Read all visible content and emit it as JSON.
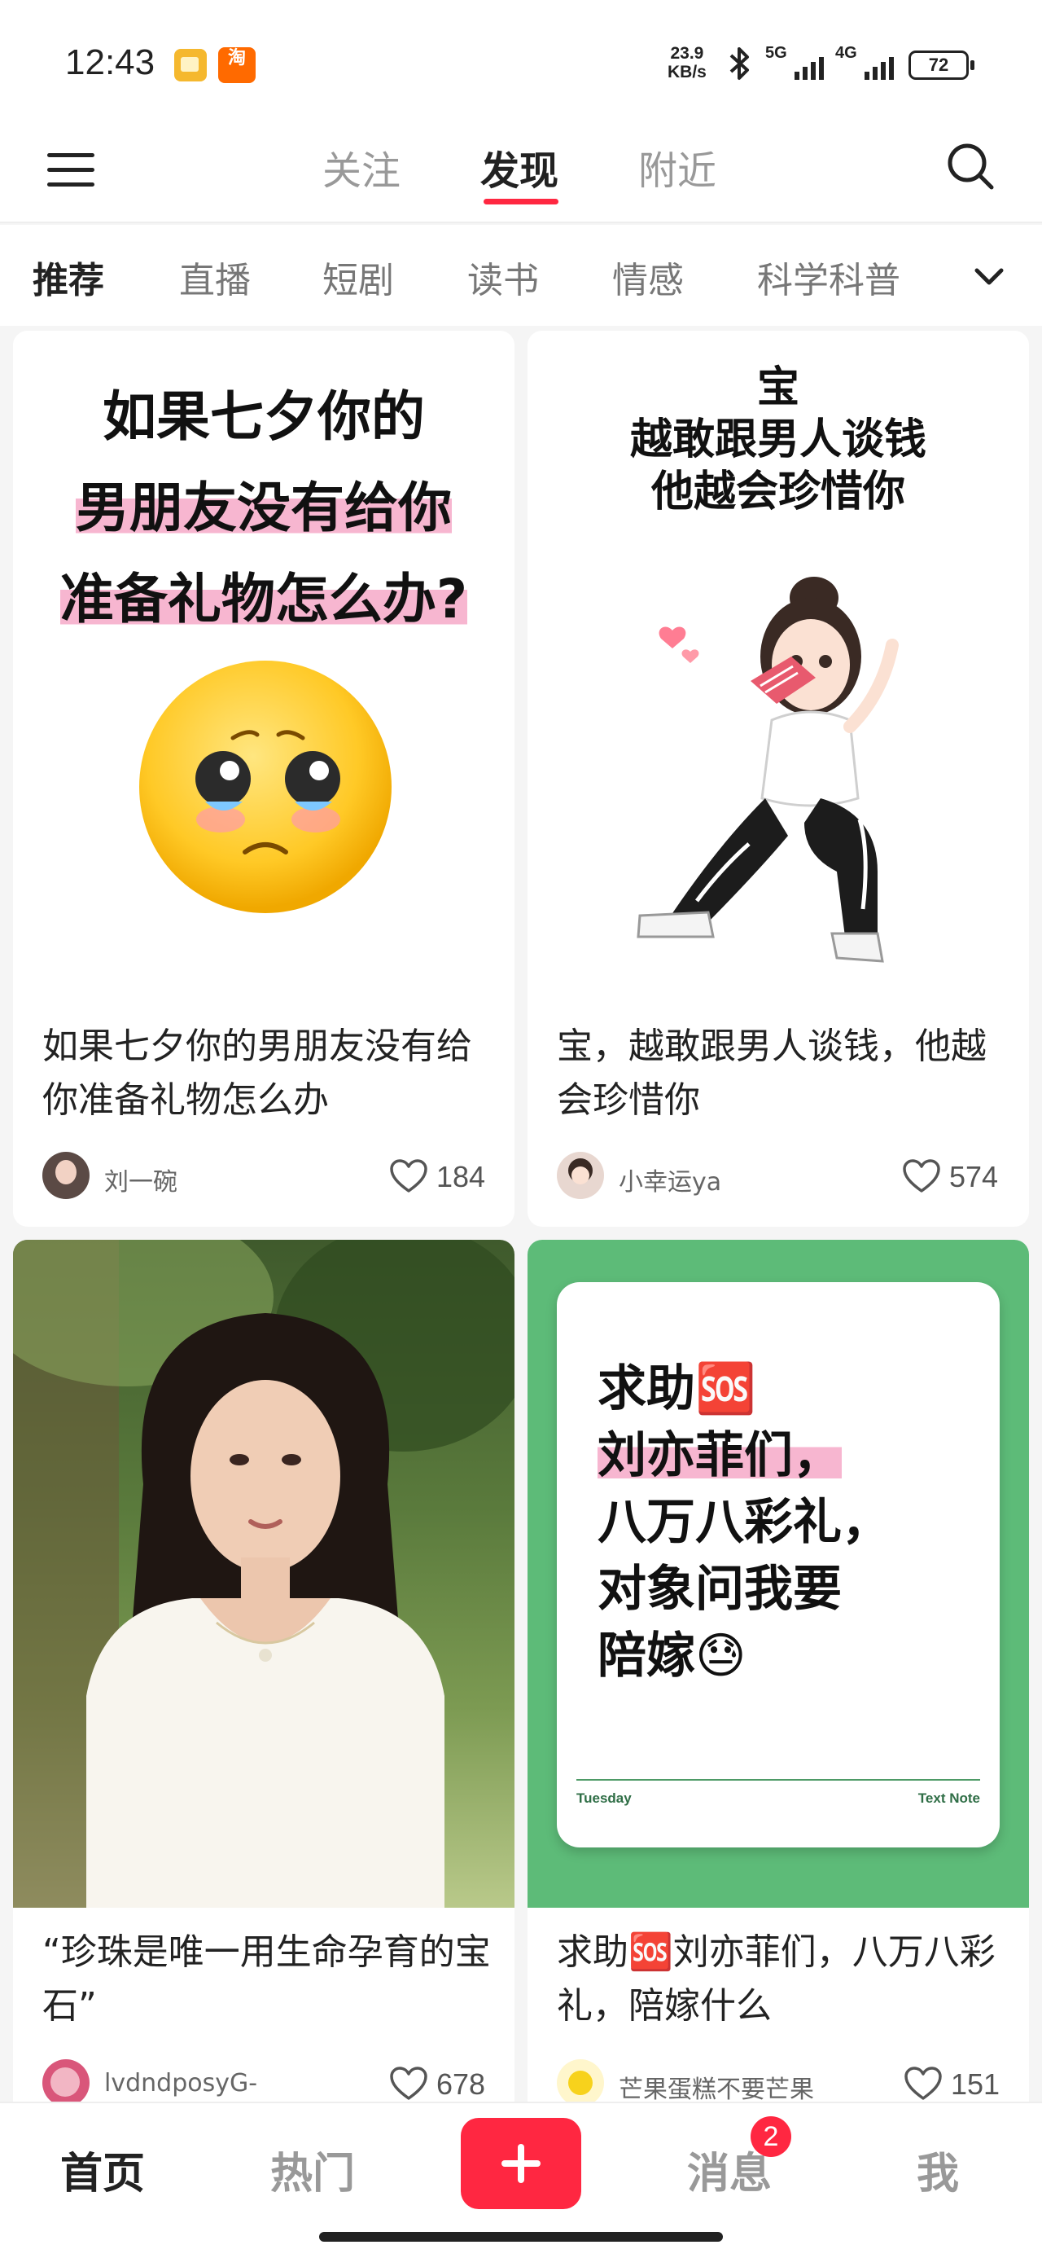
{
  "status_bar": {
    "time": "12:43",
    "net_speed_value": "23.9",
    "net_speed_unit": "KB/s",
    "signal_1": "5G",
    "signal_2": "4G",
    "battery": "72",
    "app_icon_2": "淘"
  },
  "top_nav": {
    "tabs": [
      {
        "label": "关注"
      },
      {
        "label": "发现"
      },
      {
        "label": "附近"
      }
    ],
    "active_tab": "发现",
    "accent": "#ff2741"
  },
  "channels": {
    "items": [
      "推荐",
      "直播",
      "短剧",
      "读书",
      "情感",
      "科学科普"
    ],
    "active": "推荐"
  },
  "feed": {
    "cards": [
      {
        "cover_lines": [
          "如果七夕你的",
          "男朋友没有给你",
          "准备礼物怎么办?"
        ],
        "title": "如果七夕你的男朋友没有给你准备礼物怎么办",
        "author": "刘一碗",
        "likes": "184"
      },
      {
        "cover_lines": [
          "宝",
          "越敢跟男人谈钱",
          "他越会珍惜你"
        ],
        "title": "宝，越敢跟男人谈钱，他越会珍惜你",
        "author": "小幸运ya",
        "likes": "574"
      },
      {
        "title": "“珍珠是唯一用生命孕育的宝石”",
        "author": "lvdndposyG-",
        "likes": "678"
      },
      {
        "note_lines": [
          "求助🆘",
          "刘亦菲们，",
          "八万八彩礼，",
          "对象问我要",
          "陪嫁😓"
        ],
        "note_day": "Tuesday",
        "note_app": "Text Note",
        "title": "求助🆘刘亦菲们，八万八彩礼，陪嫁什么",
        "author": "芒果蛋糕不要芒果",
        "likes": "151"
      }
    ]
  },
  "bottom_bar": {
    "home": "首页",
    "hot": "热门",
    "messages": "消息",
    "messages_badge": "2",
    "me": "我"
  }
}
